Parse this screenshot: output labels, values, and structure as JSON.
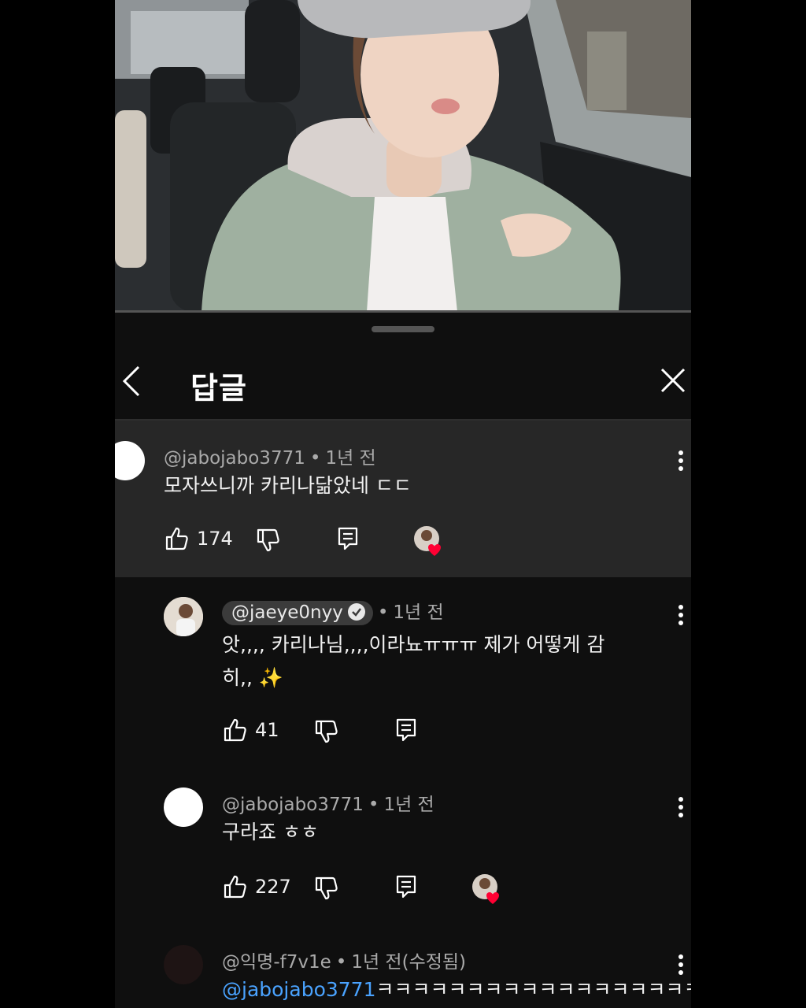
{
  "header": {
    "title": "답글"
  },
  "parent_comment": {
    "author": "@jabojabo3771",
    "time": "1년 전",
    "text": "모자쓰니까 카리나닮았네 ㄷㄷ",
    "likes": "174",
    "creator_hearted": true
  },
  "replies": [
    {
      "author": "@jaeye0nyy",
      "verified": true,
      "time": "1년 전",
      "text_line1": "앗,,,, 카리나님,,,,이라뇨ㅠㅠㅠ 제가 어떻게 감",
      "text_line2": "히,, ✨",
      "likes": "41",
      "creator_hearted": false
    },
    {
      "author": "@jabojabo3771",
      "time": "1년 전",
      "text": "구라죠 ㅎㅎ",
      "likes": "227",
      "creator_hearted": true
    },
    {
      "author": "@익명-f7v1e",
      "time": "1년 전(수정됨)",
      "mention": "@jabojabo3771",
      "text": "ㅋㅋㅋㅋㅋㅋㅋㅋㅋㅋㅋㅋㅋㅋㅋㅋㅋㅋㅋ"
    }
  ],
  "colors": {
    "background": "#0f0f0f",
    "highlight_bg": "#272727",
    "meta_text": "#aaaaaa",
    "mention": "#4aa3ff",
    "heart": "#ff0033"
  },
  "icons": [
    "back-arrow-icon",
    "close-icon",
    "thumb-up-icon",
    "thumb-down-icon",
    "reply-icon",
    "more-vert-icon",
    "heart-icon",
    "verified-check-icon"
  ]
}
